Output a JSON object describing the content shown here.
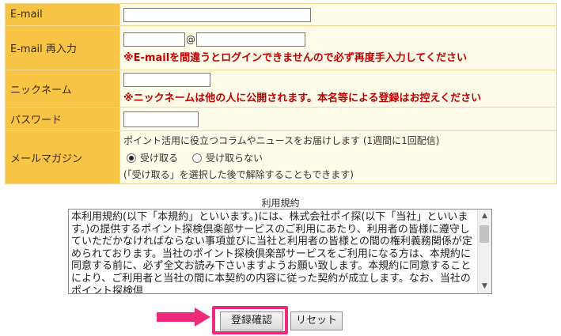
{
  "form": {
    "email": {
      "label": "E-mail",
      "value": ""
    },
    "email_confirm": {
      "label": "E-mail 再入力",
      "at_sign": "@",
      "local_value": "",
      "domain_value": "",
      "warning": "※E-mailを間違うとログインできませんので必ず再度手入力してください"
    },
    "nickname": {
      "label": "ニックネーム",
      "value": "",
      "warning": "※ニックネームは他の人に公開されます。本名等による登録はお控えください"
    },
    "password": {
      "label": "パスワード",
      "value": ""
    },
    "newsletter": {
      "label": "メールマガジン",
      "description": "ポイント活用に役立つコラムやニュースをお届けします (1週間に1回配信)",
      "options": [
        {
          "label": "受け取る",
          "selected": true
        },
        {
          "label": "受け取らない",
          "selected": false
        }
      ],
      "note": "(「受け取る」を選択した後で解除することもできます)"
    }
  },
  "terms": {
    "title": "利用規約",
    "text": "本利用規約(以下「本規約」といいます。)には、株式会社ポイ探(以下「当社」といいます。)の提供するポイント探検倶楽部サービスのご利用にあたり、利用者の皆様に遵守していただかなければならない事項並びに当社と利用者の皆様との間の権利義務関係が定められております。当社のポイント探検倶楽部サービスをご利用になる方は、本規約に同意する前に、必ず全文お読み下さいますようお願い致します。本規約に同意することにより、ご利用者と当社の間に本契約の内容に従った契約が成立します。なお、当社のポイント探検倶"
  },
  "buttons": {
    "confirm_label": "登録確認",
    "reset_label": "リセット"
  },
  "colors": {
    "label_bg": "#f8c446",
    "warning": "#c00000",
    "highlight": "#ee2a7b"
  }
}
